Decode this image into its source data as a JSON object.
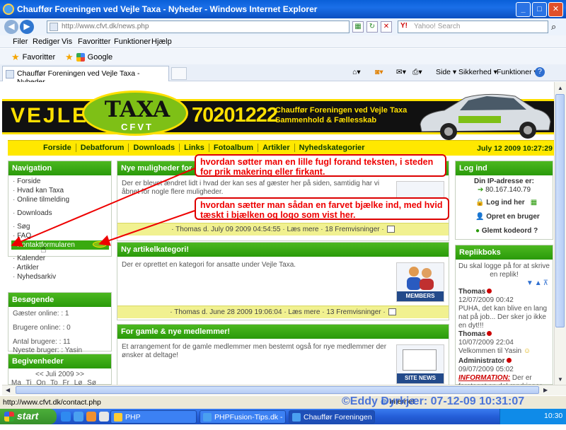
{
  "window": {
    "title": "Chauffør Foreningen ved Vejle Taxa - Nyheder - Windows Internet Explorer",
    "controls": [
      "_",
      "□",
      "✕"
    ]
  },
  "address_bar": {
    "url": "http://www.cfvt.dk/news.php",
    "search_placeholder": "Yahoo! Search",
    "search_brand": "Y!"
  },
  "menu": [
    "Filer",
    "Rediger",
    "Vis",
    "Favoritter",
    "Funktioner",
    "Hjælp"
  ],
  "favorites_bar": {
    "favorites_label": "Favoritter",
    "google_label": "Google"
  },
  "tab": {
    "title": "Chauffør Foreningen ved Vejle Taxa - Nyheder"
  },
  "command_bar": {
    "side": "Side ▾",
    "sikkerhed": "Sikkerhed ▾",
    "funktioner": "Funktioner ▾",
    "help": "?"
  },
  "banner": {
    "vejle": "VEJLE",
    "taxa": "TAXA",
    "cfvt": "CFVT",
    "phone": "70201222",
    "slogan_line1": "Chauffør Foreningen ved Vejle Taxa",
    "slogan_line2": "Sammenhold & Fællesskab"
  },
  "nav": {
    "links": [
      "Forside",
      "Debatforum",
      "Downloads",
      "Links",
      "Fotoalbum",
      "Artikler",
      "Nyhedskategorier"
    ],
    "date": "July 12 2009 10:27:29"
  },
  "left": {
    "navigation": {
      "title": "Navigation",
      "group1": [
        "Forside",
        "Hvad kan Taxa",
        "Online tilmelding"
      ],
      "group2": [
        "Downloads"
      ],
      "group3": [
        "Søg",
        "FAQ"
      ],
      "highlighted": "Kontaktformularen",
      "highlighted_display": "Kontaktformularen",
      "group4": [
        "Kalender",
        "Artikler",
        "Nyhedsarkiv"
      ]
    },
    "visitors": {
      "title": "Besøgende",
      "guests": "Gæster online: : 1",
      "members": "Brugere online: : 0",
      "total": "Antal brugere: : 11",
      "newest": "Nyeste bruger: : Yasin"
    },
    "events": {
      "title": "Begivenheder",
      "month": "<< Juli 2009 >>",
      "days": "Ma Ti On To Fr Lø Sø"
    }
  },
  "middle": {
    "news1": {
      "title": "Nye muligheder for",
      "body": "Der er blevet ændret lidt i hvad der kan ses af gæster her på siden, samtidig har vi åbnet for nogle flere muligheder.",
      "footer": "· Thomas d. July 09 2009 04:54:55 · Læs mere · 18 Fremvisninger ·"
    },
    "news2": {
      "title": "Ny artikelkategori!",
      "body": "Der er oprettet en kategori for ansatte under Vejle Taxa.",
      "image_label": "MEMBERS",
      "footer": "· Thomas d. June 28 2009 19:06:04 · Læs mere · 13 Fremvisninger ·"
    },
    "news3": {
      "title": "For gamle & nye medlemmer!",
      "body": "Et arrangement for de gamle medlemmer men bestemt også for nye medlemmer der ønsker at deltage!",
      "image_label": "SITE NEWS"
    }
  },
  "right": {
    "login": {
      "title": "Log ind",
      "ip_label": "Din IP-adresse er:",
      "ip": "80.167.140.79",
      "login_btn": "Log ind her",
      "register": "Opret en bruger",
      "forgot": "Glemt kodeord ?"
    },
    "shoutbox": {
      "title": "Replikboks",
      "notice": "Du skal logge på for at skrive en replik!",
      "entries": [
        {
          "user": "Thomas",
          "date": "12/07/2009 00:42",
          "text": "PUHA, det kan blive en lang nat på job... Der sker jo ikke en dyt!!!"
        },
        {
          "user": "Thomas",
          "date": "10/07/2009 22:04",
          "text": "Velkommen til Yasin"
        },
        {
          "user": "Administrator",
          "date": "09/07/2009 05:02",
          "label": "INFORMATION:",
          "text": "Der er foretaget en del ændringer. Man kan se om dem i"
        }
      ]
    }
  },
  "annotations": {
    "note1": "hvordan søtter man en lille fugl forand teksten, i steden for prik makering eller firkant.",
    "note2": "hvordan sætter man sådan en farvet bjælke ind, med hvid tæskt i bjælken og logo som vist her."
  },
  "status": {
    "url": "http://www.cfvt.dk/contact.php",
    "zone": "Internet",
    "watermark": "©Eddy Dyrkjær: 07-12-09 10:31:07"
  },
  "taskbar": {
    "start": "start",
    "tasks": [
      "PHP",
      "PHPFusion-Tips.dk - ...",
      "Chauffør Foreningen ..."
    ],
    "clock": "10:30"
  },
  "colors": {
    "accent_green": "#2a9a0a",
    "yellow": "#ffe800",
    "annotation_red": "#dd0000"
  }
}
